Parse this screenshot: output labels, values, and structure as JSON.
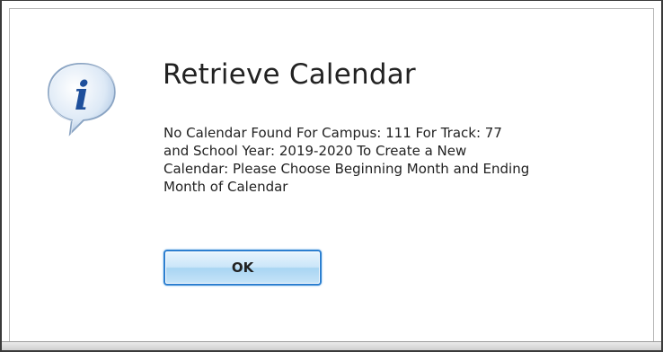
{
  "dialog": {
    "title": "Retrieve Calendar",
    "icon": "info-icon",
    "message_lines": [
      "No Calendar Found For Campus: 111 For Track: 77",
      "and School Year: 2019-2020 To Create a New",
      "Calendar: Please Choose Beginning Month and Ending",
      "Month of Calendar"
    ],
    "ok_label": "OK"
  },
  "colors": {
    "button_border": "#2c7fd0",
    "button_fill": "#cbe6f9",
    "icon_fill": "#d8e6f5",
    "icon_letter": "#1e4f9c"
  }
}
